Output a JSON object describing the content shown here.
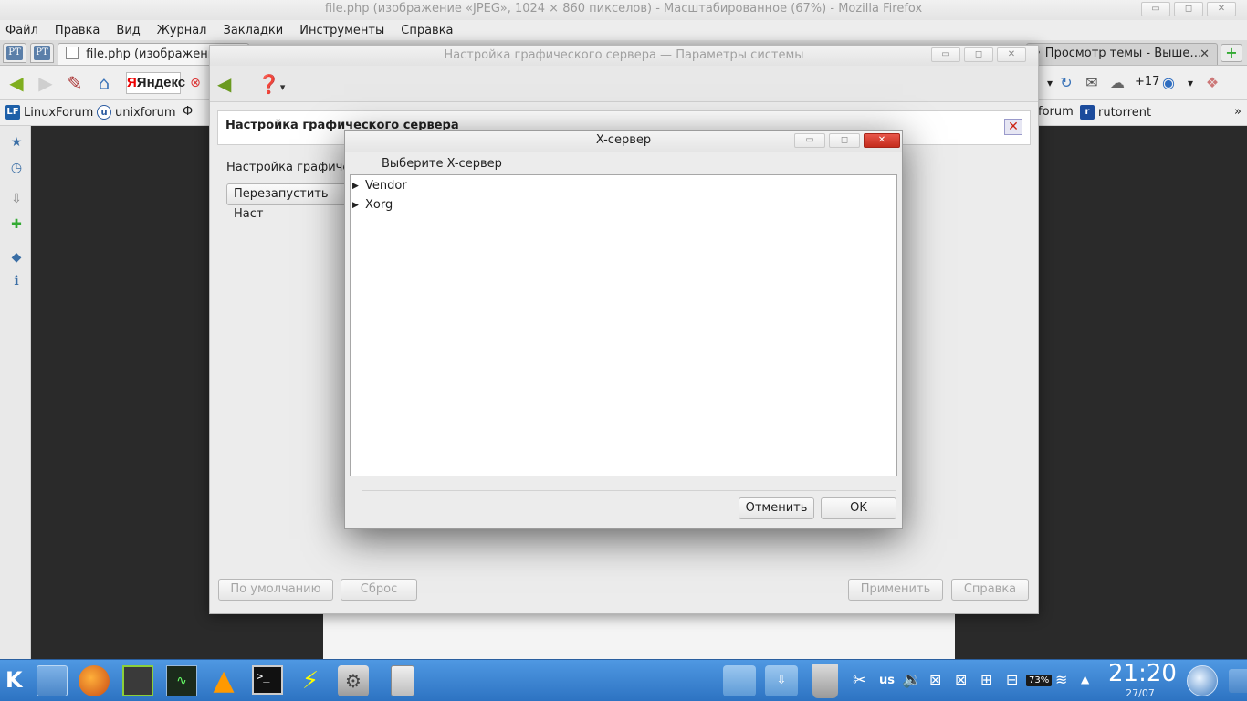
{
  "firefox": {
    "title": "file.php (изображение «JPEG», 1024 × 860 пикселов) - Масштабированное (67%) - Mozilla Firefox",
    "window_controls": {
      "minimize": "▭",
      "maximize": "◻",
      "close": "✕"
    },
    "menu": [
      "Файл",
      "Правка",
      "Вид",
      "Журнал",
      "Закладки",
      "Инструменты",
      "Справка"
    ],
    "tabs": {
      "pinned_icon_text": "PT",
      "active_tab": "file.php (изображение «",
      "right_tab": "• Просмотр темы - Выше…",
      "close_glyph": "✕",
      "new_tab_glyph": "+"
    },
    "navbar": {
      "yandex_label": "Яндекс",
      "weather": "+17"
    },
    "bookmarks": {
      "items": [
        {
          "icon": "LF",
          "label": "LinuxForum"
        },
        {
          "icon": "u",
          "label": "unixforum"
        },
        {
          "icon": "Ф",
          "label": "Ф"
        }
      ],
      "right_items": [
        {
          "label": "forum"
        },
        {
          "icon": "r",
          "label": "rutorrent"
        }
      ],
      "overflow": "»"
    }
  },
  "settings_window": {
    "title": "Настройка графического сервера — Параметры системы",
    "header_title": "Настройка графического сервера",
    "description": "Настройка графическ",
    "restart_button": "Перезапустить Наст",
    "buttons": {
      "defaults": "По умолчанию",
      "reset": "Сброс",
      "apply": "Применить",
      "help": "Справка"
    }
  },
  "xserver_dialog": {
    "title": "X-сервер",
    "prompt": "Выберите X-сервер",
    "tree_items": [
      "Vendor",
      "Xorg"
    ],
    "cancel_button": "Отменить",
    "ok_button": "OK"
  },
  "taskbar": {
    "keyboard_layout": "us",
    "battery": "73%",
    "clock_time": "21:20",
    "clock_date": "27/07"
  },
  "colors": {
    "taskbar_blue": "#2f7fd0",
    "close_red": "#d33a2c",
    "kde_green": "#6a9a1f"
  }
}
